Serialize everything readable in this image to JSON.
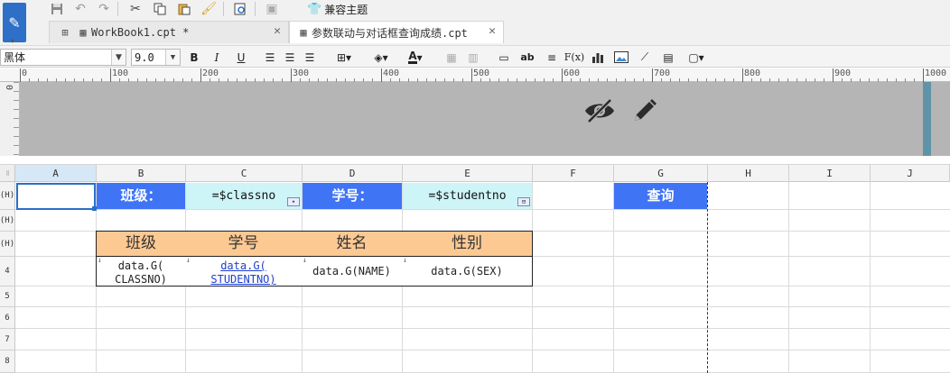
{
  "tabs": [
    {
      "label": "WorkBook1.cpt *",
      "active": false
    },
    {
      "label": "参数联动与对话框查询成绩.cpt",
      "active": true
    }
  ],
  "toolbar": {
    "compat_theme_label": "兼容主题",
    "font_name": "黑体",
    "font_size": "9.0"
  },
  "ruler": {
    "labels": [
      "0",
      "100",
      "200",
      "300",
      "400",
      "500",
      "600",
      "700",
      "800",
      "900",
      "1000"
    ],
    "left_label": "0"
  },
  "sheet": {
    "columns": [
      "A",
      "B",
      "C",
      "D",
      "E",
      "F",
      "G",
      "H",
      "I",
      "J"
    ],
    "row_headers": [
      "(H)",
      "(H)",
      "(H)",
      "4",
      "5",
      "6",
      "7",
      "8"
    ],
    "cells": {
      "B1": "班级：",
      "C1": "=$classno",
      "D1": "学号：",
      "E1": "=$studentno",
      "G1": "查询",
      "B3": "班级",
      "C3": "学号",
      "D3": "姓名",
      "E3": "性别",
      "B4": "data.G(\nCLASSNO)",
      "C4": "data.G(\nSTUDENTNO)",
      "D4": "data.G(NAME)",
      "E4": "data.G(SEX)"
    }
  },
  "colors": {
    "param_blue": "#3f74f5",
    "param_cyan": "#cdf4f7",
    "header_orange": "#fdc993",
    "selection": "#2a6ec9"
  },
  "icons": {
    "header_icons": [
      "eye-slash-icon",
      "pencil-icon"
    ]
  }
}
